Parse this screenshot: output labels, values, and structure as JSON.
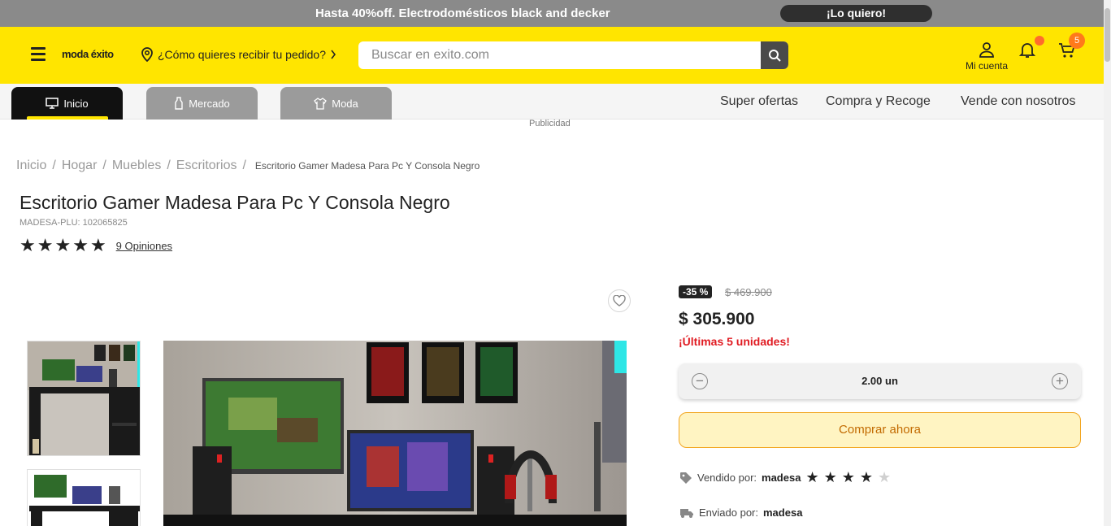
{
  "promo": {
    "text": "Hasta 40%off. Electrodomésticos black and decker",
    "cta": "¡Lo quiero!"
  },
  "header": {
    "logo": "moda éxito",
    "delivery_text": "¿Cómo quieres recibir tu pedido?",
    "search_placeholder": "Buscar en exito.com",
    "account_label": "Mi cuenta",
    "cart_count": "5"
  },
  "nav": {
    "tabs": [
      {
        "label": "Inicio",
        "icon": "monitor-icon"
      },
      {
        "label": "Mercado",
        "icon": "bottle-icon"
      },
      {
        "label": "Moda",
        "icon": "shirt-icon"
      }
    ],
    "links": [
      "Super ofertas",
      "Compra y Recoge",
      "Vende con nosotros"
    ]
  },
  "ad_label": "Publicidad",
  "breadcrumb": {
    "items": [
      "Inicio",
      "Hogar",
      "Muebles",
      "Escritorios"
    ],
    "current": "Escritorio Gamer Madesa Para Pc Y Consola Negro"
  },
  "product": {
    "title": "Escritorio Gamer Madesa Para Pc Y Consola Negro",
    "sku": "MADESA-PLU: 102065825",
    "rating": 5,
    "reviews": "9 Opiniones",
    "discount": "-35 %",
    "old_price": "$ 469.900",
    "price": "$ 305.900",
    "stock": "¡Últimas 5 unidades!",
    "quantity": "2.00 un",
    "buy_label": "Comprar ahora",
    "sold_by_label": "Vendido por:",
    "sold_by": "madesa",
    "seller_rating": 4,
    "shipped_by_label": "Enviado por:",
    "shipped_by": "madesa"
  },
  "colors": {
    "brand_yellow": "#ffe500",
    "promo_gray": "#8a8a8a",
    "alert_red": "#e01b22",
    "buy_orange": "#f2a51f"
  }
}
